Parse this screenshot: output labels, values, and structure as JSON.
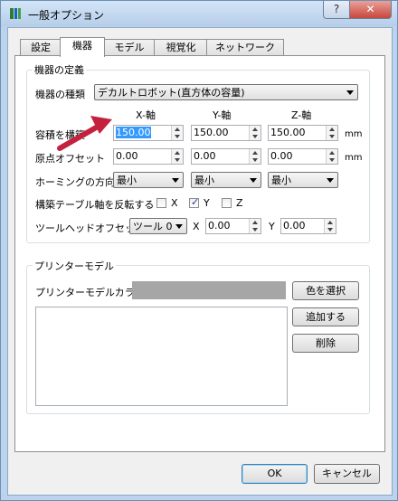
{
  "window": {
    "title": "一般オプション",
    "help_label": "?",
    "close_label": "✕"
  },
  "tabs": [
    {
      "label": "設定"
    },
    {
      "label": "機器"
    },
    {
      "label": "モデル"
    },
    {
      "label": "視覚化"
    },
    {
      "label": "ネットワーク"
    }
  ],
  "active_tab": "機器",
  "machine": {
    "group_title": "機器の定義",
    "type_label": "機器の種類",
    "type_value": "デカルトロボット(直方体の容量)",
    "axis_headers": [
      "X-軸",
      "Y-軸",
      "Z-軸"
    ],
    "build_volume": {
      "label": "容積を構築",
      "x": "150.00",
      "y": "150.00",
      "z": "150.00",
      "unit": "mm"
    },
    "origin_offset": {
      "label": "原点オフセット",
      "x": "0.00",
      "y": "0.00",
      "z": "0.00",
      "unit": "mm"
    },
    "homing": {
      "label": "ホーミングの方向",
      "x": "最小",
      "y": "最小",
      "z": "最小"
    },
    "invert_bed": {
      "label": "構築テーブル軸を反転する",
      "x_label": "X",
      "x_checked": false,
      "y_label": "Y",
      "y_checked": true,
      "z_label": "Z",
      "z_checked": false
    },
    "tool_offset": {
      "label": "ツールヘッドオフセット",
      "tool": "ツール 0",
      "x_label": "X",
      "x": "0.00",
      "y_label": "Y",
      "y": "0.00"
    }
  },
  "printer_model": {
    "group_title": "プリンターモデル",
    "color_label": "プリンターモデルカラー",
    "color_value": "#a6a6a6",
    "choose_color_button": "色を選択",
    "add_button": "追加する",
    "delete_button": "削除"
  },
  "footer": {
    "ok": "OK",
    "cancel": "キャンセル"
  },
  "colors": {
    "annotation_arrow": "#c4213f",
    "selection": "#3399ff"
  },
  "icons": {
    "app": "app-icon",
    "arrow": "annotation-arrow-icon"
  }
}
